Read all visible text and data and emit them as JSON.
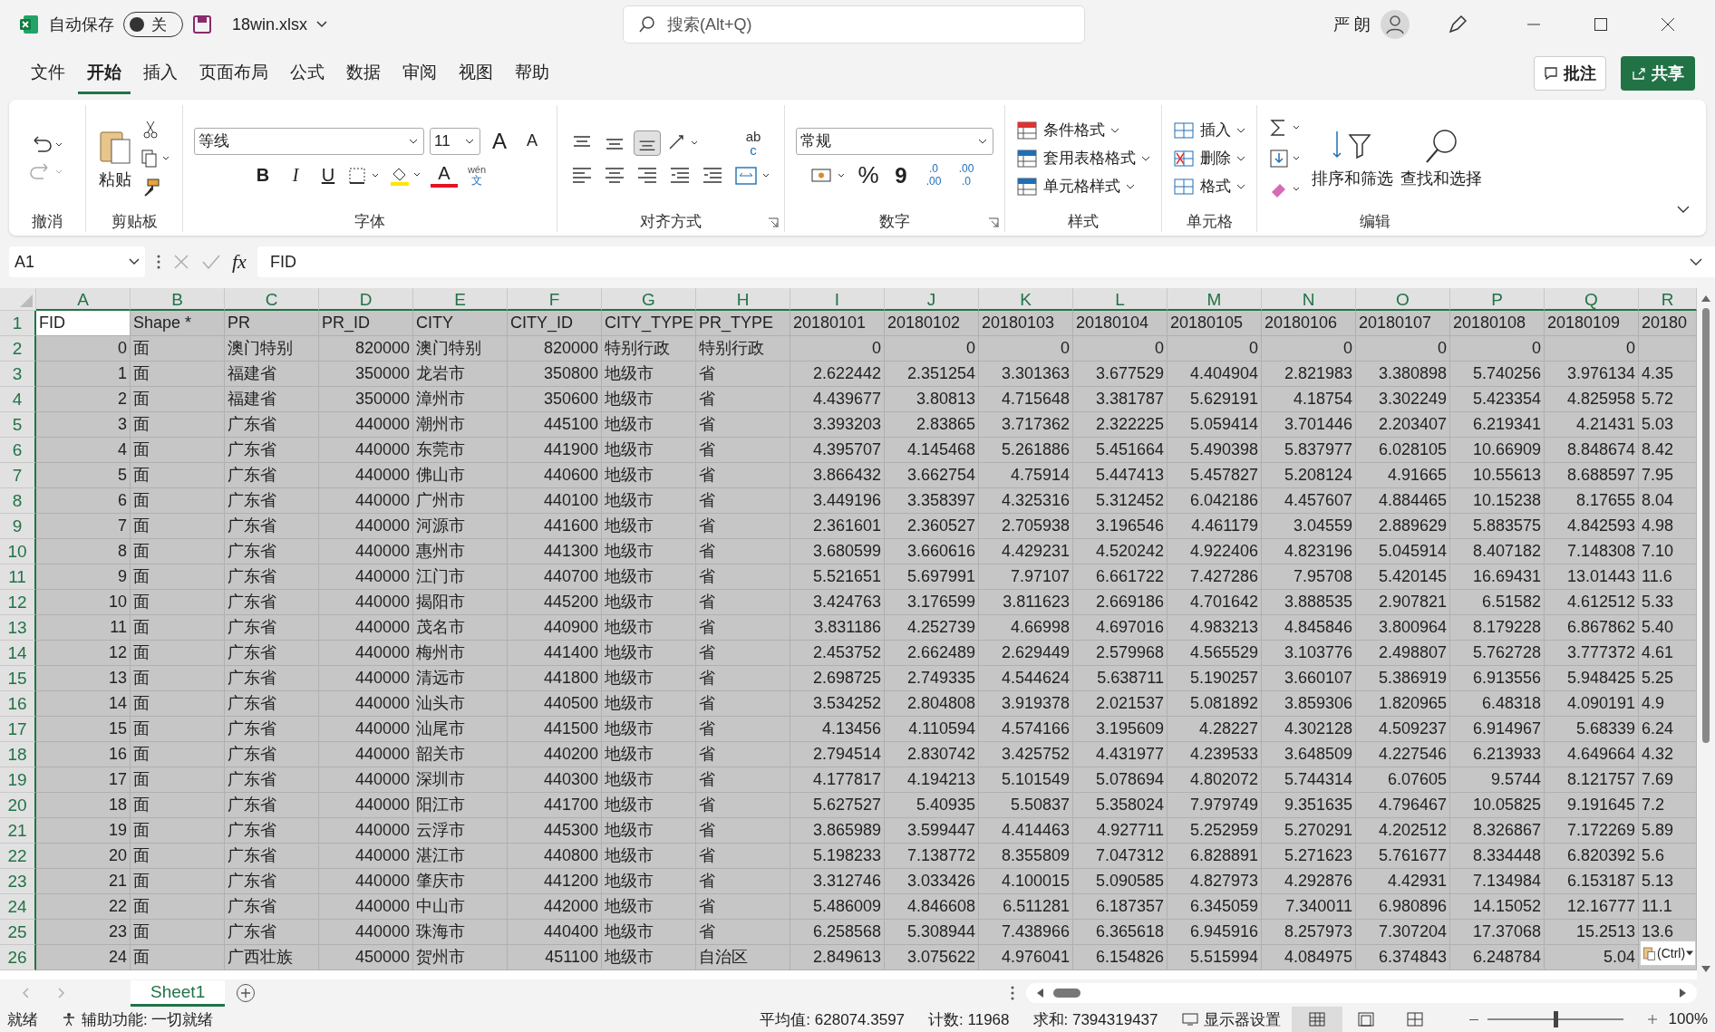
{
  "title_bar": {
    "autosave_label": "自动保存",
    "autosave_state": "关",
    "autosave_on": false,
    "file_name": "18win.xlsx",
    "search_placeholder": "搜索(Alt+Q)",
    "user_name": "严 朗"
  },
  "menu_tabs": [
    {
      "label": "文件",
      "selected": false
    },
    {
      "label": "开始",
      "selected": true
    },
    {
      "label": "插入",
      "selected": false
    },
    {
      "label": "页面布局",
      "selected": false
    },
    {
      "label": "公式",
      "selected": false
    },
    {
      "label": "数据",
      "selected": false
    },
    {
      "label": "审阅",
      "selected": false
    },
    {
      "label": "视图",
      "selected": false
    },
    {
      "label": "帮助",
      "selected": false
    }
  ],
  "comments_button": "批注",
  "share_button": "共享",
  "undo_group": {
    "label": "撤消"
  },
  "clipboard_group": {
    "label": "剪贴板",
    "paste": "粘贴"
  },
  "font_group": {
    "label": "字体",
    "font_name": "等线",
    "font_size": "11",
    "grow": "A",
    "shrink": "A",
    "bold": "B",
    "italic": "I",
    "underline": "U",
    "font_color": "A",
    "phonetic_top": "wén",
    "phonetic_bottom": "文"
  },
  "alignment_group": {
    "label": "对齐方式",
    "wrap_top": "ab",
    "wrap_bottom": "c"
  },
  "number_group": {
    "label": "数字",
    "format": "常规",
    "percent": "%",
    "comma": "9",
    "increase_decimal": [
      ".0",
      ".00"
    ],
    "decrease_decimal": [
      ".00",
      ".0"
    ]
  },
  "styles_group": {
    "label": "样式",
    "items": [
      "条件格式",
      "套用表格格式",
      "单元格样式"
    ]
  },
  "cells_group": {
    "label": "单元格",
    "items": [
      "插入",
      "删除",
      "格式"
    ]
  },
  "editing_group": {
    "label": "编辑",
    "sort_filter": "排序和筛选",
    "find_select": "查找和选择"
  },
  "formula_bar": {
    "name_box": "A1",
    "fx": "fx",
    "formula": "FID"
  },
  "grid": {
    "columns": [
      {
        "letter": "A",
        "kind": "number"
      },
      {
        "letter": "B",
        "kind": "text"
      },
      {
        "letter": "C",
        "kind": "text"
      },
      {
        "letter": "D",
        "kind": "number"
      },
      {
        "letter": "E",
        "kind": "text"
      },
      {
        "letter": "F",
        "kind": "number"
      },
      {
        "letter": "G",
        "kind": "text"
      },
      {
        "letter": "H",
        "kind": "text"
      },
      {
        "letter": "I",
        "kind": "number"
      },
      {
        "letter": "J",
        "kind": "number"
      },
      {
        "letter": "K",
        "kind": "number"
      },
      {
        "letter": "L",
        "kind": "number"
      },
      {
        "letter": "M",
        "kind": "number"
      },
      {
        "letter": "N",
        "kind": "number"
      },
      {
        "letter": "O",
        "kind": "number"
      },
      {
        "letter": "P",
        "kind": "number"
      },
      {
        "letter": "Q",
        "kind": "number"
      },
      {
        "letter": "R",
        "kind": "clipped"
      }
    ],
    "header_row": {
      "number": "1",
      "cells": [
        {
          "text": "FID",
          "active": true
        },
        {
          "text": "Shape *",
          "active": false
        },
        {
          "text": "PR",
          "active": false
        },
        {
          "text": "PR_ID",
          "active": false
        },
        {
          "text": "CITY",
          "active": false
        },
        {
          "text": "CITY_ID",
          "active": false
        },
        {
          "text": "CITY_TYPE",
          "active": false
        },
        {
          "text": "PR_TYPE",
          "active": false
        },
        {
          "text": "20180101",
          "active": false
        },
        {
          "text": "20180102",
          "active": false
        },
        {
          "text": "20180103",
          "active": false
        },
        {
          "text": "20180104",
          "active": false
        },
        {
          "text": "20180105",
          "active": false
        },
        {
          "text": "20180106",
          "active": false
        },
        {
          "text": "20180107",
          "active": false
        },
        {
          "text": "20180108",
          "active": false
        },
        {
          "text": "20180109",
          "active": false
        },
        {
          "text": "20180",
          "active": false
        }
      ]
    },
    "rows": [
      {
        "number": "2",
        "cells": [
          "0",
          "面",
          "澳门特别",
          "820000",
          "澳门特别",
          "820000",
          "特别行政",
          "特别行政",
          "0",
          "0",
          "0",
          "0",
          "0",
          "0",
          "0",
          "0",
          "0"
        ]
      },
      {
        "number": "3",
        "cells": [
          "1",
          "面",
          "福建省",
          "350000",
          "龙岩市",
          "350800",
          "地级市",
          "省",
          "2.622442",
          "2.351254",
          "3.301363",
          "3.677529",
          "4.404904",
          "2.821983",
          "3.380898",
          "5.740256",
          "3.976134",
          "4.35"
        ]
      },
      {
        "number": "4",
        "cells": [
          "2",
          "面",
          "福建省",
          "350000",
          "漳州市",
          "350600",
          "地级市",
          "省",
          "4.439677",
          "3.80813",
          "4.715648",
          "3.381787",
          "5.629191",
          "4.18754",
          "3.302249",
          "5.423354",
          "4.825958",
          "5.72"
        ]
      },
      {
        "number": "5",
        "cells": [
          "3",
          "面",
          "广东省",
          "440000",
          "潮州市",
          "445100",
          "地级市",
          "省",
          "3.393203",
          "2.83865",
          "3.717362",
          "2.322225",
          "5.059414",
          "3.701446",
          "2.203407",
          "6.219341",
          "4.21431",
          "5.03"
        ]
      },
      {
        "number": "6",
        "cells": [
          "4",
          "面",
          "广东省",
          "440000",
          "东莞市",
          "441900",
          "地级市",
          "省",
          "4.395707",
          "4.145468",
          "5.261886",
          "5.451664",
          "5.490398",
          "5.837977",
          "6.028105",
          "10.66909",
          "8.848674",
          "8.42"
        ]
      },
      {
        "number": "7",
        "cells": [
          "5",
          "面",
          "广东省",
          "440000",
          "佛山市",
          "440600",
          "地级市",
          "省",
          "3.866432",
          "3.662754",
          "4.75914",
          "5.447413",
          "5.457827",
          "5.208124",
          "4.91665",
          "10.55613",
          "8.688597",
          "7.95"
        ]
      },
      {
        "number": "8",
        "cells": [
          "6",
          "面",
          "广东省",
          "440000",
          "广州市",
          "440100",
          "地级市",
          "省",
          "3.449196",
          "3.358397",
          "4.325316",
          "5.312452",
          "6.042186",
          "4.457607",
          "4.884465",
          "10.15238",
          "8.17655",
          "8.04"
        ]
      },
      {
        "number": "9",
        "cells": [
          "7",
          "面",
          "广东省",
          "440000",
          "河源市",
          "441600",
          "地级市",
          "省",
          "2.361601",
          "2.360527",
          "2.705938",
          "3.196546",
          "4.461179",
          "3.04559",
          "2.889629",
          "5.883575",
          "4.842593",
          "4.98"
        ]
      },
      {
        "number": "10",
        "cells": [
          "8",
          "面",
          "广东省",
          "440000",
          "惠州市",
          "441300",
          "地级市",
          "省",
          "3.680599",
          "3.660616",
          "4.429231",
          "4.520242",
          "4.922406",
          "4.823196",
          "5.045914",
          "8.407182",
          "7.148308",
          "7.10"
        ]
      },
      {
        "number": "11",
        "cells": [
          "9",
          "面",
          "广东省",
          "440000",
          "江门市",
          "440700",
          "地级市",
          "省",
          "5.521651",
          "5.697991",
          "7.97107",
          "6.661722",
          "7.427286",
          "7.95708",
          "5.420145",
          "16.69431",
          "13.01443",
          "11.6"
        ]
      },
      {
        "number": "12",
        "cells": [
          "10",
          "面",
          "广东省",
          "440000",
          "揭阳市",
          "445200",
          "地级市",
          "省",
          "3.424763",
          "3.176599",
          "3.811623",
          "2.669186",
          "4.701642",
          "3.888535",
          "2.907821",
          "6.51582",
          "4.612512",
          "5.33"
        ]
      },
      {
        "number": "13",
        "cells": [
          "11",
          "面",
          "广东省",
          "440000",
          "茂名市",
          "440900",
          "地级市",
          "省",
          "3.831186",
          "4.252739",
          "4.66998",
          "4.697016",
          "4.983213",
          "4.845846",
          "3.800964",
          "8.179228",
          "6.867862",
          "5.40"
        ]
      },
      {
        "number": "14",
        "cells": [
          "12",
          "面",
          "广东省",
          "440000",
          "梅州市",
          "441400",
          "地级市",
          "省",
          "2.453752",
          "2.662489",
          "2.629449",
          "2.579968",
          "4.565529",
          "3.103776",
          "2.498807",
          "5.762728",
          "3.777372",
          "4.61"
        ]
      },
      {
        "number": "15",
        "cells": [
          "13",
          "面",
          "广东省",
          "440000",
          "清远市",
          "441800",
          "地级市",
          "省",
          "2.698725",
          "2.749335",
          "4.544624",
          "5.638711",
          "5.190257",
          "3.660107",
          "5.386919",
          "6.913556",
          "5.948425",
          "5.25"
        ]
      },
      {
        "number": "16",
        "cells": [
          "14",
          "面",
          "广东省",
          "440000",
          "汕头市",
          "440500",
          "地级市",
          "省",
          "3.534252",
          "2.804808",
          "3.919378",
          "2.021537",
          "5.081892",
          "3.859306",
          "1.820965",
          "6.48318",
          "4.090191",
          "4.9"
        ]
      },
      {
        "number": "17",
        "cells": [
          "15",
          "面",
          "广东省",
          "440000",
          "汕尾市",
          "441500",
          "地级市",
          "省",
          "4.13456",
          "4.110594",
          "4.574166",
          "3.195609",
          "4.28227",
          "4.302128",
          "4.509237",
          "6.914967",
          "5.68339",
          "6.24"
        ]
      },
      {
        "number": "18",
        "cells": [
          "16",
          "面",
          "广东省",
          "440000",
          "韶关市",
          "440200",
          "地级市",
          "省",
          "2.794514",
          "2.830742",
          "3.425752",
          "4.431977",
          "4.239533",
          "3.648509",
          "4.227546",
          "6.213933",
          "4.649664",
          "4.32"
        ]
      },
      {
        "number": "19",
        "cells": [
          "17",
          "面",
          "广东省",
          "440000",
          "深圳市",
          "440300",
          "地级市",
          "省",
          "4.177817",
          "4.194213",
          "5.101549",
          "5.078694",
          "4.802072",
          "5.744314",
          "6.07605",
          "9.5744",
          "8.121757",
          "7.69"
        ]
      },
      {
        "number": "20",
        "cells": [
          "18",
          "面",
          "广东省",
          "440000",
          "阳江市",
          "441700",
          "地级市",
          "省",
          "5.627527",
          "5.40935",
          "5.50837",
          "5.358024",
          "7.979749",
          "9.351635",
          "4.796467",
          "10.05825",
          "9.191645",
          "7.2"
        ]
      },
      {
        "number": "21",
        "cells": [
          "19",
          "面",
          "广东省",
          "440000",
          "云浮市",
          "445300",
          "地级市",
          "省",
          "3.865989",
          "3.599447",
          "4.414463",
          "4.927711",
          "5.252959",
          "5.270291",
          "4.202512",
          "8.326867",
          "7.172269",
          "5.89"
        ]
      },
      {
        "number": "22",
        "cells": [
          "20",
          "面",
          "广东省",
          "440000",
          "湛江市",
          "440800",
          "地级市",
          "省",
          "5.198233",
          "7.138772",
          "8.355809",
          "7.047312",
          "6.828891",
          "5.271623",
          "5.761677",
          "8.334448",
          "6.820392",
          "5.6"
        ]
      },
      {
        "number": "23",
        "cells": [
          "21",
          "面",
          "广东省",
          "440000",
          "肇庆市",
          "441200",
          "地级市",
          "省",
          "3.312746",
          "3.033426",
          "4.100015",
          "5.090585",
          "4.827973",
          "4.292876",
          "4.42931",
          "7.134984",
          "6.153187",
          "5.13"
        ]
      },
      {
        "number": "24",
        "cells": [
          "22",
          "面",
          "广东省",
          "440000",
          "中山市",
          "442000",
          "地级市",
          "省",
          "5.486009",
          "4.846608",
          "6.511281",
          "6.187357",
          "6.345059",
          "7.340011",
          "6.980896",
          "14.15052",
          "12.16777",
          "11.1"
        ]
      },
      {
        "number": "25",
        "cells": [
          "23",
          "面",
          "广东省",
          "440000",
          "珠海市",
          "440400",
          "地级市",
          "省",
          "6.258568",
          "5.308944",
          "7.438966",
          "6.365618",
          "6.945916",
          "8.257973",
          "7.307204",
          "17.37068",
          "15.2513",
          "13.6"
        ]
      },
      {
        "number": "26",
        "cells": [
          "24",
          "面",
          "广西壮族",
          "450000",
          "贺州市",
          "451100",
          "地级市",
          "自治区",
          "2.849613",
          "3.075622",
          "4.976041",
          "6.154826",
          "5.515994",
          "4.084975",
          "6.374843",
          "6.248784",
          "5.04"
        ]
      }
    ],
    "paste_options": "(Ctrl)"
  },
  "sheet_tabs": [
    {
      "label": "Sheet1",
      "selected": true
    }
  ],
  "status_bar": {
    "ready": "就绪",
    "accessibility": "辅助功能: 一切就绪",
    "average": "平均值: 628074.3597",
    "count": "计数: 11968",
    "sum": "求和: 7394319437",
    "display_settings": "显示器设置",
    "views": [
      {
        "kind": "normal",
        "selected": true
      },
      {
        "kind": "page_layout",
        "selected": false
      },
      {
        "kind": "page_break",
        "selected": false
      }
    ],
    "zoom": {
      "level": 0.5,
      "label": "100%"
    }
  }
}
